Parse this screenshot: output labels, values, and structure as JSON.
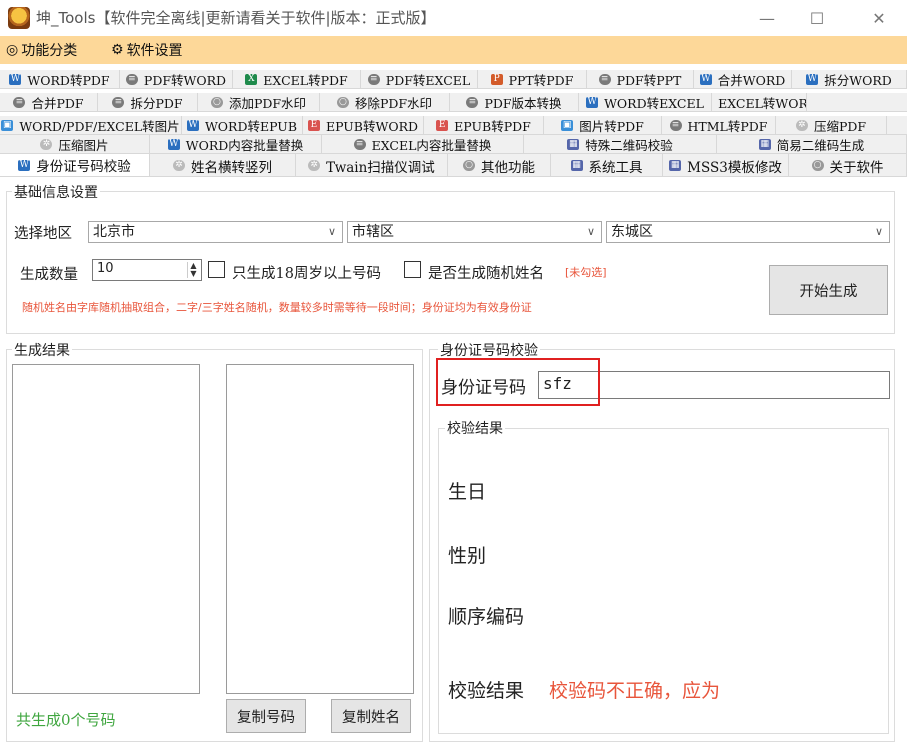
{
  "window": {
    "title": "坤_Tools【软件完全离线|更新请看关于软件|版本：正式版】",
    "minimize": "—",
    "maximize": "☐",
    "close": "✕"
  },
  "menu": {
    "categories_icon": "◎",
    "categories": "功能分类",
    "settings_icon": "⚙",
    "settings": "软件设置"
  },
  "tabs": {
    "row1": [
      {
        "label": "WORD转PDF",
        "icon": "w"
      },
      {
        "label": "PDF转WORD",
        "icon": "p"
      },
      {
        "label": "EXCEL转PDF",
        "icon": "x"
      },
      {
        "label": "PDF转EXCEL",
        "icon": "p"
      },
      {
        "label": "PPT转PDF",
        "icon": "pp"
      },
      {
        "label": "PDF转PPT",
        "icon": "p"
      },
      {
        "label": "合并WORD",
        "icon": "w"
      },
      {
        "label": "拆分WORD",
        "icon": "w"
      }
    ],
    "row2": [
      {
        "label": "合并PDF",
        "icon": "p"
      },
      {
        "label": "拆分PDF",
        "icon": "p"
      },
      {
        "label": "添加PDF水印",
        "icon": "o"
      },
      {
        "label": "移除PDF水印",
        "icon": "o"
      },
      {
        "label": "PDF版本转换",
        "icon": "p"
      },
      {
        "label": "WORD转EXCEL",
        "icon": "w"
      },
      {
        "label": "EXCEL转WORD",
        "icon": "x"
      }
    ],
    "row3": [
      {
        "label": "WORD/PDF/EXCEL转图片",
        "icon": "img"
      },
      {
        "label": "WORD转EPUB",
        "icon": "w"
      },
      {
        "label": "EPUB转WORD",
        "icon": "e"
      },
      {
        "label": "EPUB转PDF",
        "icon": "e"
      },
      {
        "label": "图片转PDF",
        "icon": "img"
      },
      {
        "label": "HTML转PDF",
        "icon": "p"
      },
      {
        "label": "压缩PDF",
        "icon": "z"
      }
    ],
    "row4": [
      {
        "label": "压缩图片",
        "icon": "z"
      },
      {
        "label": "WORD内容批量替换",
        "icon": "w"
      },
      {
        "label": "EXCEL内容批量替换",
        "icon": "p"
      },
      {
        "label": "特殊二维码校验",
        "icon": "q"
      },
      {
        "label": "简易二维码生成",
        "icon": "q"
      }
    ],
    "row5": [
      {
        "label": "身份证号码校验",
        "icon": "w",
        "active": true
      },
      {
        "label": "姓名横转竖列",
        "icon": "z"
      },
      {
        "label": "Twain扫描仪调试",
        "icon": "z"
      },
      {
        "label": "其他功能",
        "icon": "o"
      },
      {
        "label": "系统工具",
        "icon": "q"
      },
      {
        "label": "MSS3模板修改",
        "icon": "q"
      },
      {
        "label": "关于软件",
        "icon": "o"
      }
    ]
  },
  "basic": {
    "legend": "基础信息设置",
    "region_label": "选择地区",
    "province": "北京市",
    "city": "市辖区",
    "district": "东城区",
    "count_label": "生成数量",
    "count_value": "10",
    "adult_only": "只生成18周岁以上号码",
    "random_name": "是否生成随机姓名",
    "unchecked_note": "[未勾选]",
    "hint": "随机姓名由字库随机抽取组合，二字/三字姓名随机，数量较多时需等待一段时间；身份证均为有效身份证",
    "start_button": "开始生成"
  },
  "result": {
    "legend": "生成结果",
    "total": "共生成0个号码",
    "copy_numbers": "复制号码",
    "copy_names": "复制姓名"
  },
  "verify": {
    "legend": "身份证号码校验",
    "id_label": "身份证号码",
    "id_value": "sfz",
    "result_legend": "校验结果",
    "birthday_label": "生日",
    "gender_label": "性别",
    "sequence_label": "顺序编码",
    "check_label": "校验结果",
    "check_value": "校验码不正确，应为"
  },
  "colors": {
    "menu_bg": "#fdd899",
    "hint_red": "#e8553b",
    "success_green": "#3fa63f",
    "highlight_box": "#e02020"
  }
}
